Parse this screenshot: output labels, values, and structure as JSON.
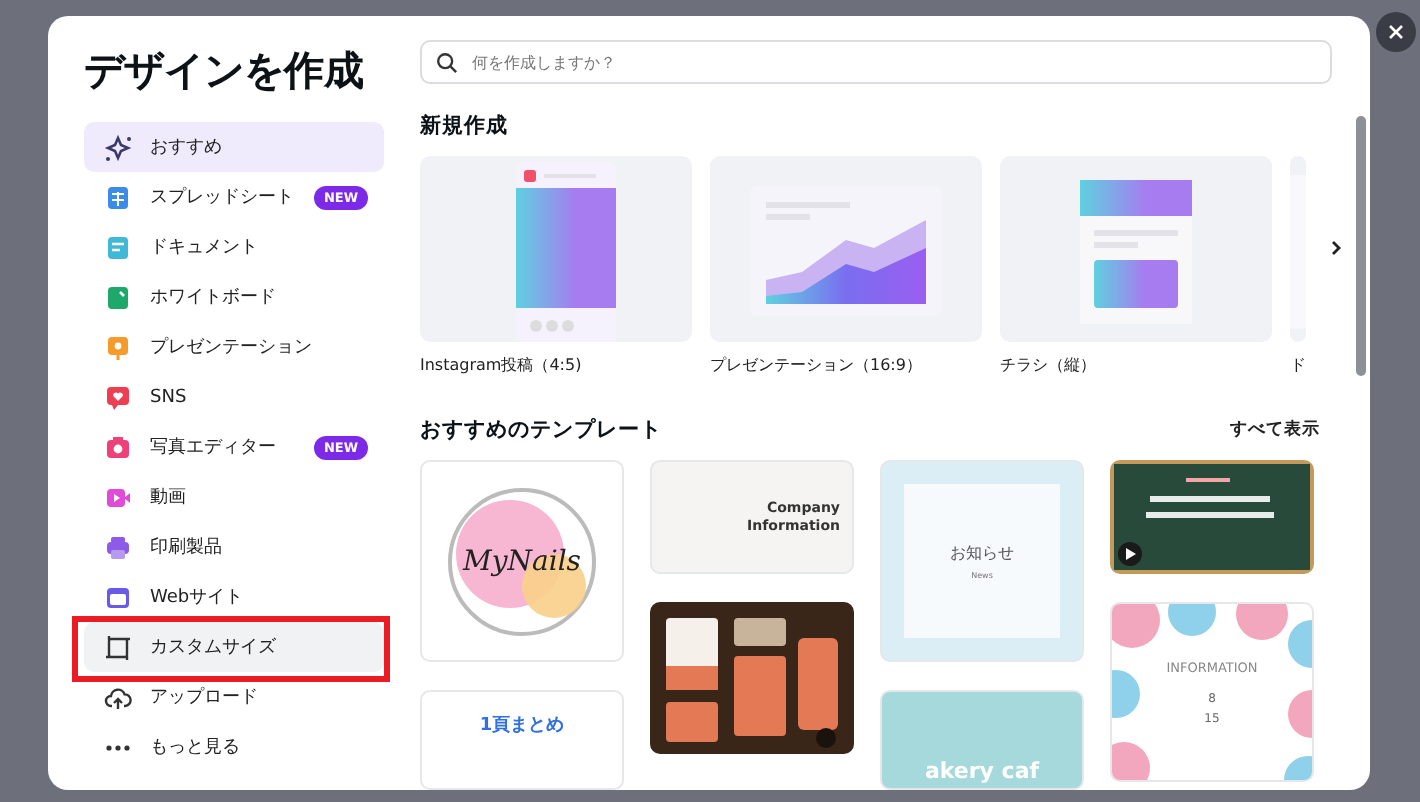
{
  "window": {
    "title": "デザインを作成"
  },
  "sidebar": {
    "items": [
      {
        "kind": "recommend",
        "label": "おすすめ",
        "selected": true,
        "highlighted": false
      },
      {
        "kind": "sheet",
        "label": "スプレッドシート",
        "badge": "NEW",
        "selected": false,
        "highlighted": false
      },
      {
        "kind": "doc",
        "label": "ドキュメント",
        "selected": false,
        "highlighted": false
      },
      {
        "kind": "whiteboard",
        "label": "ホワイトボード",
        "selected": false,
        "highlighted": false
      },
      {
        "kind": "presentation",
        "label": "プレゼンテーション",
        "selected": false,
        "highlighted": false
      },
      {
        "kind": "sns",
        "label": "SNS",
        "selected": false,
        "highlighted": false
      },
      {
        "label": "写真エディター",
        "badge": "NEW",
        "selected": false,
        "highlighted": false
      },
      {
        "kind": "video",
        "label": "動画",
        "selected": false,
        "highlighted": false
      },
      {
        "kind": "print",
        "label": "印刷製品",
        "selected": false,
        "highlighted": false
      },
      {
        "kind": "web",
        "label": "Webサイト",
        "selected": false,
        "highlighted": false
      },
      {
        "kind": "custom",
        "label": "カスタムサイズ",
        "selected": false,
        "highlighted": true
      },
      {
        "kind": "upload",
        "label": "アップロード",
        "selected": false,
        "highlighted": false
      },
      {
        "kind": "more",
        "label": "もっと見る",
        "selected": false,
        "highlighted": false
      }
    ]
  },
  "search": {
    "placeholder": "何を作成しますか？"
  },
  "new_design": {
    "title": "新規作成",
    "cards": [
      {
        "kind": "instagram",
        "label": "Instagram投稿（4:5)"
      },
      {
        "kind": "presentation",
        "label": "プレゼンテーション（16:9）"
      },
      {
        "kind": "flyer",
        "label": "チラシ（縦）"
      },
      {
        "kind": "doc",
        "label": "ド"
      }
    ]
  },
  "templates": {
    "title": "おすすめのテンプレート",
    "see_all": "すべて表示",
    "columns": [
      [
        {
          "kind": "nails",
          "texts": [
            "MyNails"
          ]
        },
        {
          "kind": "summary",
          "texts": [
            "1頁まとめ"
          ]
        }
      ],
      [
        {
          "kind": "company",
          "texts": [
            "Company",
            "Information"
          ]
        },
        {
          "kind": "picture_dark"
        }
      ],
      [
        {
          "kind": "notice",
          "texts": [
            "お知らせ",
            "News"
          ]
        },
        {
          "kind": "bakery",
          "texts": [
            "akery caf"
          ]
        }
      ],
      [
        {
          "kind": "picture_chalk"
        },
        {
          "kind": "info",
          "texts": [
            "INFORMATION",
            "8",
            "15"
          ]
        }
      ]
    ]
  }
}
